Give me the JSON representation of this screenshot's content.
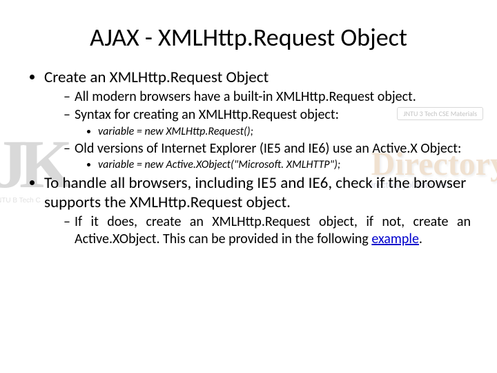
{
  "watermark": {
    "left_letters_j": "J",
    "left_letters_k": "K",
    "left_sub": "JNTU B Tech C",
    "right_big": "Directory!",
    "right_url": "irectory.yolasite.com",
    "pill": "JNTU 3 Tech CSE Materials"
  },
  "title": "AJAX - XMLHttp.Request Object",
  "bullets": {
    "b1": "Create an XMLHttp.Request Object",
    "b1_1": "All modern browsers have a built-in XMLHttp.Request object.",
    "b1_2": "Syntax for creating an XMLHttp.Request object:",
    "b1_2_1": "variable = new XMLHttp.Request();",
    "b1_3": "Old versions of Internet Explorer (IE5 and IE6) use an Active.X Object:",
    "b1_3_1": "variable = new Active.XObject(\"Microsoft. XMLHTTP\");",
    "b2": "To handle all browsers, including IE5 and IE6, check if the browser supports the XMLHttp.Request object.",
    "b2_1_pre": "If it does, create an XMLHttp.Request object, if not, create an Active.XObject. This can be provided in the following ",
    "b2_1_link": "example",
    "b2_1_post": "."
  }
}
